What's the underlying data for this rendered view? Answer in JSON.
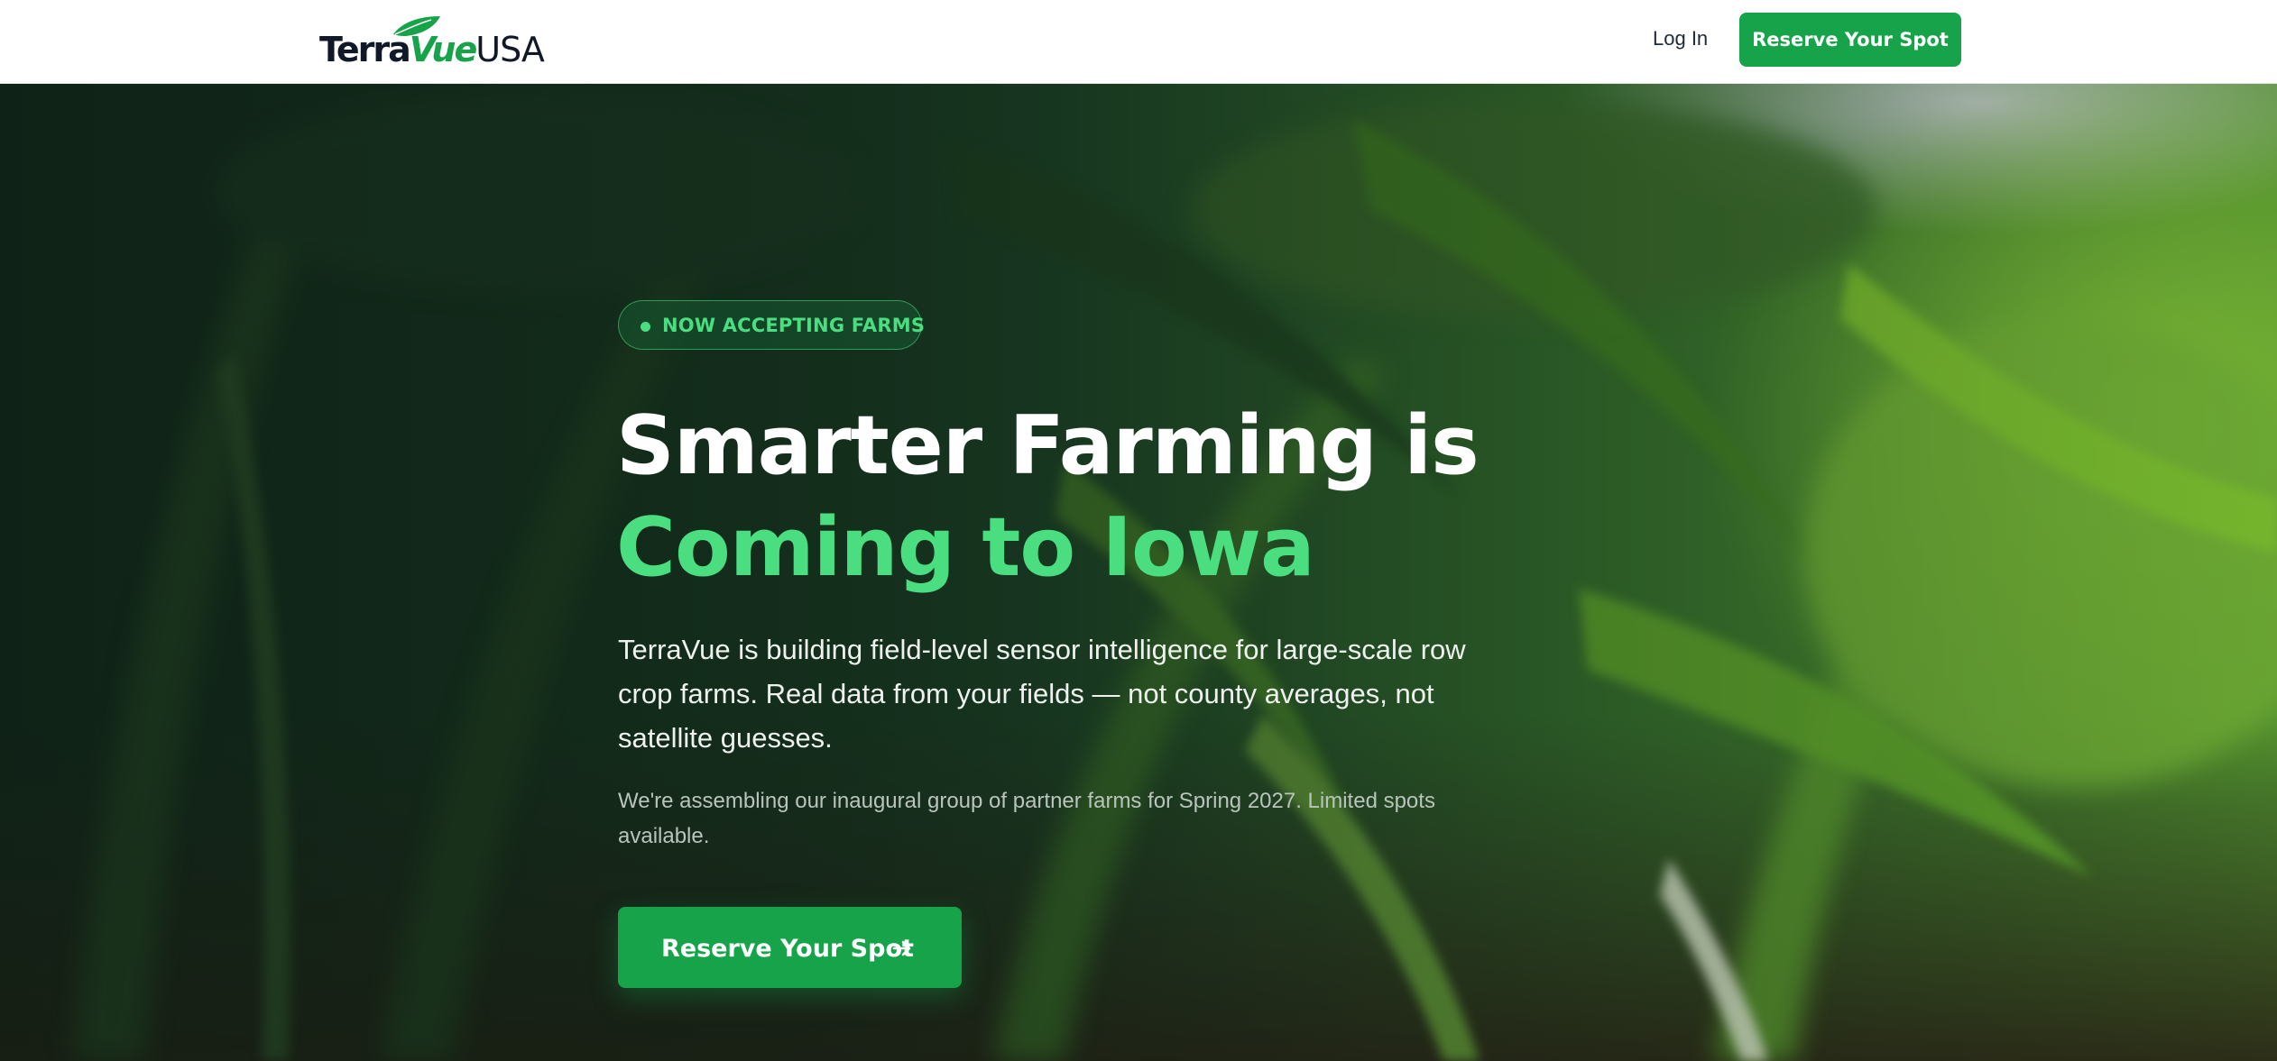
{
  "header": {
    "logo": {
      "part1": "Terra",
      "part2": "Vue",
      "part3": "USA"
    },
    "login_label": "Log In",
    "cta_label": "Reserve Your Spot"
  },
  "hero": {
    "badge": "NOW ACCEPTING FARMS",
    "headline_line1": "Smarter Farming is",
    "headline_line2": "Coming to Iowa",
    "lead": "TerraVue is building field-level sensor intelligence for large-scale row crop farms. Real data from your fields — not county averages, not satellite guesses.",
    "note": "We're assembling our inaugural group of partner farms for Spring 2027. Limited spots available.",
    "cta_label": "Reserve Your Spot",
    "cta_icon": "arrow-right-icon",
    "background": "corn-field-photo"
  },
  "colors": {
    "brand_green": "#17a34a",
    "accent_green": "#4ade80",
    "header_bg": "#ffffff",
    "text_dark": "#111827"
  }
}
